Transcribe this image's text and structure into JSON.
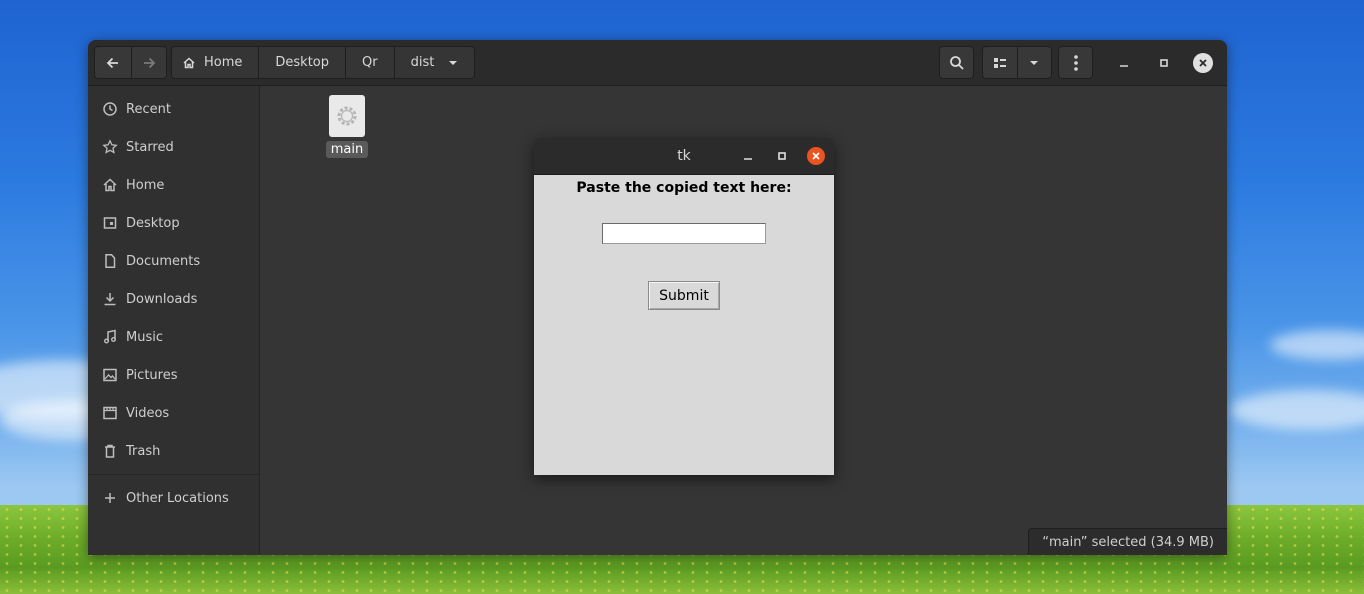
{
  "file_manager": {
    "pathbar": [
      "Home",
      "Desktop",
      "Qr",
      "dist"
    ],
    "sidebar": {
      "places": [
        "Recent",
        "Starred",
        "Home",
        "Desktop",
        "Documents",
        "Downloads",
        "Music",
        "Pictures",
        "Videos",
        "Trash"
      ],
      "other_locations": "Other Locations"
    },
    "files": [
      {
        "name": "main",
        "icon": "executable-gear-icon"
      }
    ],
    "status": "“main” selected  (34.9 MB)"
  },
  "dialog": {
    "title": "tk",
    "prompt": "Paste the copied text here:",
    "entry_value": "",
    "submit_label": "Submit"
  },
  "colors": {
    "window_bg": "#353535",
    "headerbar_bg": "#2b2b2b",
    "tk_body_bg": "#d9d9d9",
    "close_accent": "#e95420"
  }
}
